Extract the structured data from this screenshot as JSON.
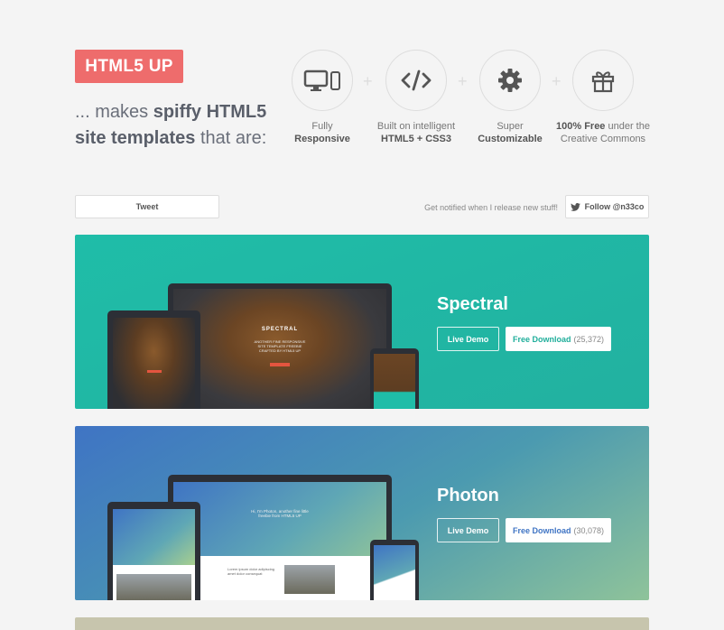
{
  "header": {
    "logo": "HTML5 UP",
    "tagline_prefix": "... makes ",
    "tagline_bold1": "spiffy HTML5",
    "tagline_bold2": "site templates",
    "tagline_suffix": " that are:"
  },
  "features": [
    {
      "icon": "desktop-mobile-icon",
      "line1": "Fully",
      "line2": "Responsive"
    },
    {
      "icon": "code-icon",
      "line1": "Built on intelligent",
      "line2": "HTML5 + CSS3"
    },
    {
      "icon": "gear-icon",
      "line1": "Super",
      "line2": "Customizable"
    },
    {
      "icon": "gift-icon",
      "line1_bold": "100% Free",
      "line1_rest": " under the",
      "line2": "Creative Commons"
    }
  ],
  "social": {
    "tweet_label": "Tweet",
    "notify_text": "Get notified when I release new stuff!",
    "follow_label": "Follow @n33co"
  },
  "templates": [
    {
      "name": "Spectral",
      "live_demo": "Live Demo",
      "download_label": "Free Download",
      "download_count": "(25,372)",
      "preview_title": "SPECTRAL",
      "preview_sub": "ANOTHER FINE RESPONSIVE SITE TEMPLATE FREEBIE CRAFTED BY HTML5 UP"
    },
    {
      "name": "Photon",
      "live_demo": "Live Demo",
      "download_label": "Free Download",
      "download_count": "(30,078)",
      "preview_title": "Hi, I'm Photon, another fine little freebie from HTML5 UP",
      "preview_sub": "Lorem ipsum dolor adipiscing amet dolor consequat"
    }
  ],
  "colors": {
    "logo_bg": "#ee6c6c",
    "spectral_bg": "#1fbda8",
    "photon_bg": "#3f74c4"
  }
}
